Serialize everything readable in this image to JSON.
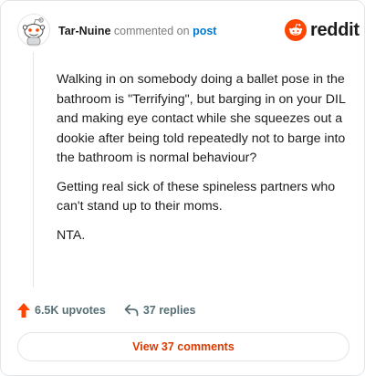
{
  "comment": {
    "username": "Tar-Nuine",
    "commented_text": "commented on",
    "post_link": "post",
    "paragraphs": [
      "Walking in on somebody doing a ballet pose in the bathroom is \"Terrifying\", but barging in on your DIL and making eye contact while she squeezes out a dookie after being told repeatedly not to barge into the bathroom is normal behaviour?",
      "Getting real sick of these spineless partners who can't stand up to their moms.",
      "NTA."
    ]
  },
  "brand": {
    "wordmark": "reddit",
    "icon": "reddit-snoo-icon",
    "color": "#ff4500"
  },
  "actions": {
    "upvotes_label": "6.5K upvotes",
    "replies_label": "37 replies"
  },
  "view_comments_label": "View 37 comments",
  "colors": {
    "accent": "#ff4500",
    "link": "#0079d3",
    "view_button_text": "#d93a00",
    "muted": "#576f76"
  }
}
